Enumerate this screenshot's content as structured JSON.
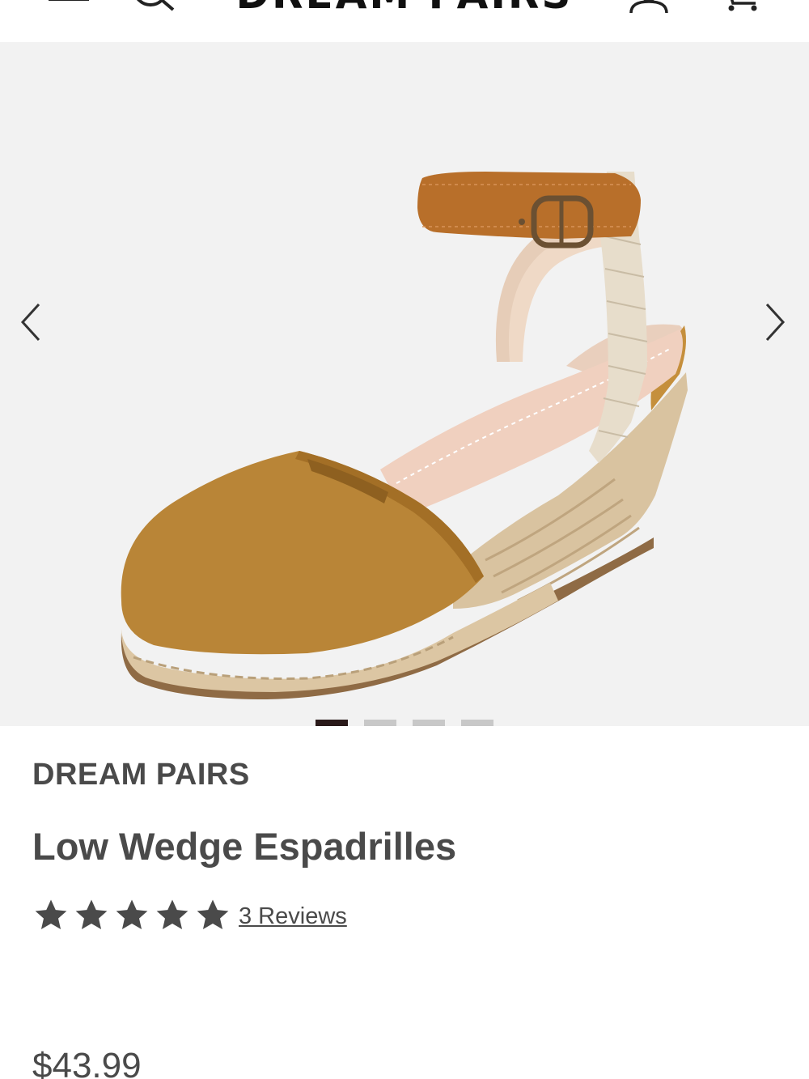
{
  "header": {
    "logo_text": "DREAM PAIRS",
    "icons": [
      "menu-icon",
      "search-icon",
      "account-icon",
      "cart-icon"
    ]
  },
  "gallery": {
    "image_subject": "tan suede closed-toe espadrille wedge with ankle strap",
    "slide_count": 4,
    "active_slide": 1,
    "colors": {
      "background": "#f2f2f2",
      "active_dot": "#2a1a1a",
      "inactive_dot": "#c8c8c8"
    }
  },
  "product": {
    "brand": "DREAM PAIRS",
    "title": "Low Wedge Espadrilles",
    "rating": 5,
    "reviews_label": "3 Reviews",
    "price": "$43.99"
  },
  "colors": {
    "text": "#4a4a4a",
    "star": "#4a4a4a"
  }
}
